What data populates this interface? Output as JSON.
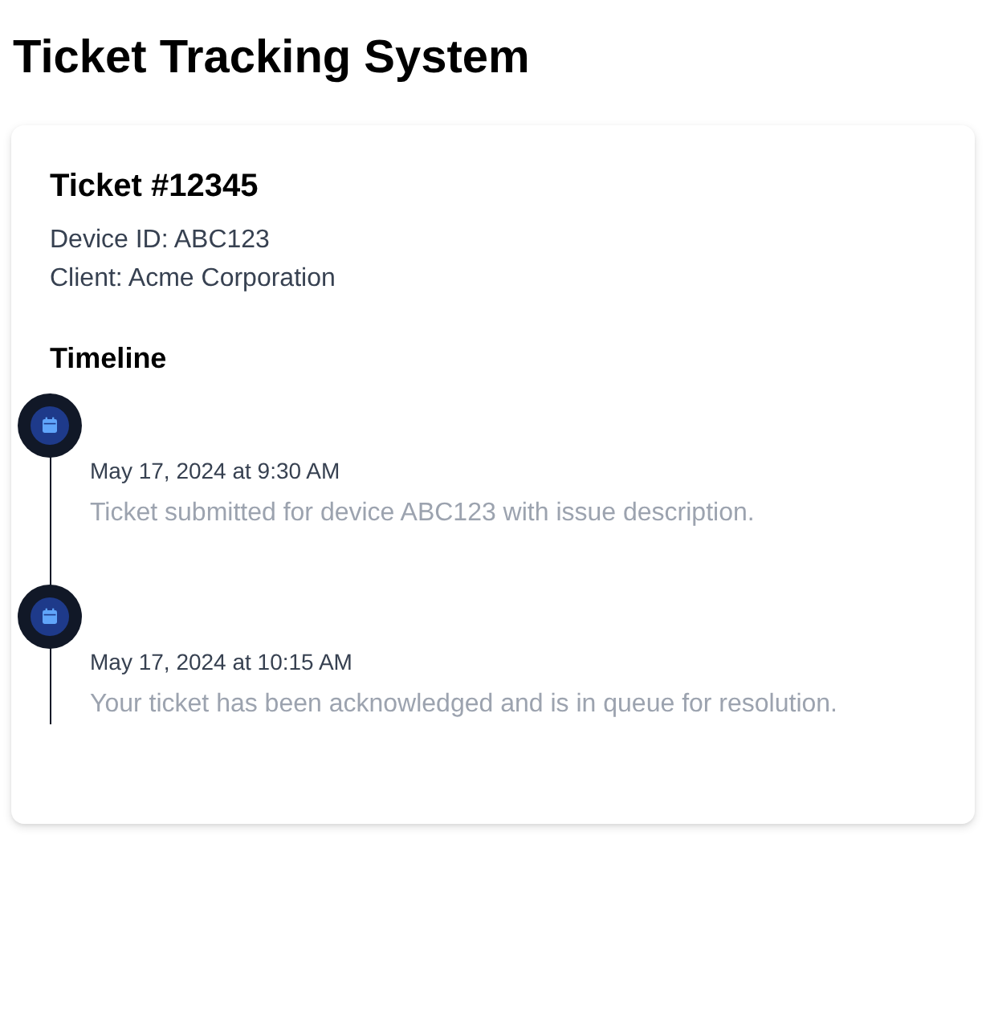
{
  "page": {
    "title": "Ticket Tracking System"
  },
  "ticket": {
    "title": "Ticket #12345",
    "details": [
      "Device ID: ABC123",
      "Client: Acme Corporation"
    ]
  },
  "timeline": {
    "heading": "Timeline",
    "events": [
      {
        "date": "May 17, 2024 at 9:30 AM",
        "description": "Ticket submitted for device ABC123 with issue description."
      },
      {
        "date": "May 17, 2024 at 10:15 AM",
        "description": "Your ticket has been acknowledged and is in queue for resolution."
      }
    ]
  }
}
